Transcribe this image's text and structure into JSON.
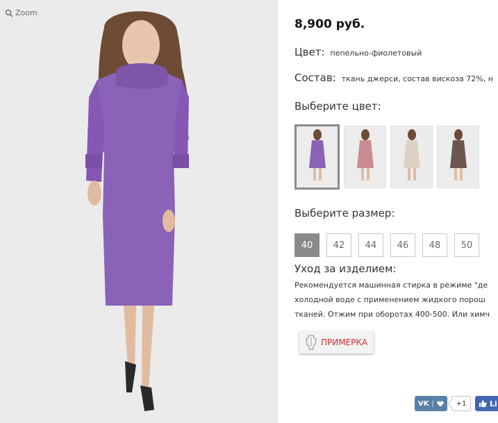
{
  "gallery": {
    "zoom_label": "Zoom"
  },
  "product": {
    "price": "8,900 руб.",
    "color_label": "Цвет:",
    "color_value": "пепельно-фиолетовый",
    "composition_label": "Состав:",
    "composition_value": "ткань джерси, состав вискоза 72%, н",
    "choose_color_label": "Выберите цвет:",
    "color_options": [
      "#8a62b8",
      "#c98a92",
      "#dcd2c4",
      "#6b5650"
    ],
    "choose_size_label": "Выберите размер:",
    "sizes": [
      "40",
      "42",
      "44",
      "46",
      "48",
      "50"
    ],
    "selected_size": "40",
    "care_title": "Уход за изделием:",
    "care_lines": [
      "Рекомендуется машинная стирка в режиме \"де",
      "холодной воде с применением жидкого порош",
      "тканей. Отжим при оборотах 400-500. Или химч"
    ],
    "try_on_label": "ПРИМЕРКА"
  },
  "social": {
    "vk_label": "VK",
    "share_count": "+1",
    "fb_label": "Li"
  },
  "colors": {
    "dress": "#8a62b8",
    "accent_red": "#d62a2a",
    "vk_blue": "#5a7fa8",
    "fb_blue": "#4267b2"
  }
}
